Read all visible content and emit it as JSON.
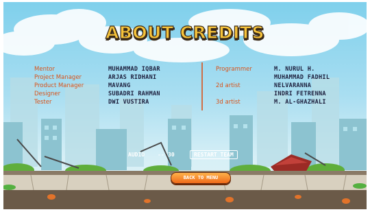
{
  "title": "ABOUT CREDITS",
  "credits_left": [
    {
      "role": "Mentor",
      "name": "MUHAMMAD IQBAR"
    },
    {
      "role": "Project Manager",
      "name": "ARJAS RIDHANI"
    },
    {
      "role": "Product Manager",
      "name": "MAVANG"
    },
    {
      "role": "Designer",
      "name": "SUBADRI RAHMAN"
    },
    {
      "role": "Tester",
      "name": "DWI VUSTIRA"
    }
  ],
  "credits_right": [
    {
      "role": "Programmer",
      "name": "M. NURUL H."
    },
    {
      "role": "",
      "name": "MUHAMMAD FADHIL"
    },
    {
      "role": "2d artist",
      "name": "NELVARANNA"
    },
    {
      "role": "",
      "name": "INDRI FETRENNA"
    },
    {
      "role": "3d artist",
      "name": "M. AL-GHAZHALI"
    }
  ],
  "counter": {
    "label": "AUDIO",
    "dash": "--",
    "value": "30",
    "restart_label": "RESTART TEAM"
  },
  "main_button": {
    "label": "BACK TO MENU"
  },
  "colors": {
    "title_fill": "#f6c33b",
    "title_outline": "#3a2a18",
    "role_text": "#d9531a",
    "name_text": "#1c1e3c",
    "button": "#ef6a1a",
    "sky_top": "#7fd0ec"
  }
}
